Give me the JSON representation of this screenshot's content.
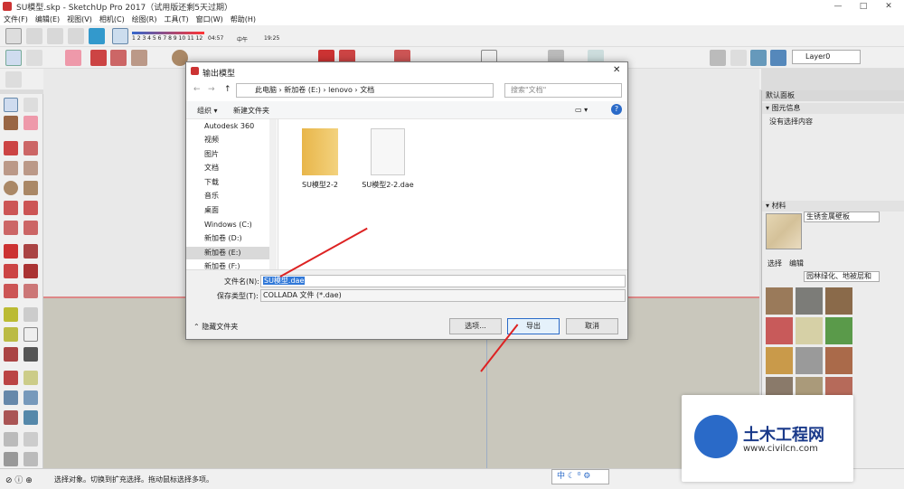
{
  "window": {
    "title": "SU模型.skp - SketchUp Pro 2017（试用版还剩5天过期）",
    "minimize": "—",
    "maximize": "□",
    "close": "✕"
  },
  "menu": [
    "文件(F)",
    "编辑(E)",
    "视图(V)",
    "相机(C)",
    "绘图(R)",
    "工具(T)",
    "窗口(W)",
    "帮助(H)"
  ],
  "shadow_scale": {
    "hours": "1 2 3 4 5 6 7 8 9 10 11 12",
    "time1": "04:57",
    "noon": "中午",
    "time2": "19:25"
  },
  "layer": {
    "value": "Layer0"
  },
  "panel": {
    "title": "默认面板",
    "entity_info": "图元信息",
    "no_selection": "没有选择内容",
    "materials": "材料",
    "material_name": "生锈金属壁板",
    "tab_select": "选择",
    "tab_edit": "编辑",
    "library": "园林绿化、地被层和"
  },
  "dialog": {
    "title": "输出模型",
    "breadcrumb": [
      "此电脑",
      "新加卷 (E:)",
      "lenovo",
      "文档"
    ],
    "search_placeholder": "搜索\"文档\"",
    "organize": "组织 ▾",
    "new_folder": "新建文件夹",
    "nav": [
      "Autodesk 360",
      "视频",
      "图片",
      "文档",
      "下载",
      "音乐",
      "桌面",
      "Windows (C:)",
      "新加卷 (D:)",
      "新加卷 (E:)",
      "新加卷 (F:)"
    ],
    "files": [
      {
        "name": "SU模型2-2",
        "type": "folder"
      },
      {
        "name": "SU模型2-2.dae",
        "type": "file"
      }
    ],
    "filename_label": "文件名(N):",
    "filename_value": "SU模型.dae",
    "filetype_label": "保存类型(T):",
    "filetype_value": "COLLADA 文件 (*.dae)",
    "hide_folders": "隐藏文件夹",
    "options": "选项...",
    "export": "导出",
    "cancel": "取消"
  },
  "status": {
    "text": "选择对象。切换到扩充选择。拖动鼠标选择多项。",
    "ime": "中"
  },
  "watermark": {
    "brand": "土木工程网",
    "url": "www.civilcn.com"
  }
}
